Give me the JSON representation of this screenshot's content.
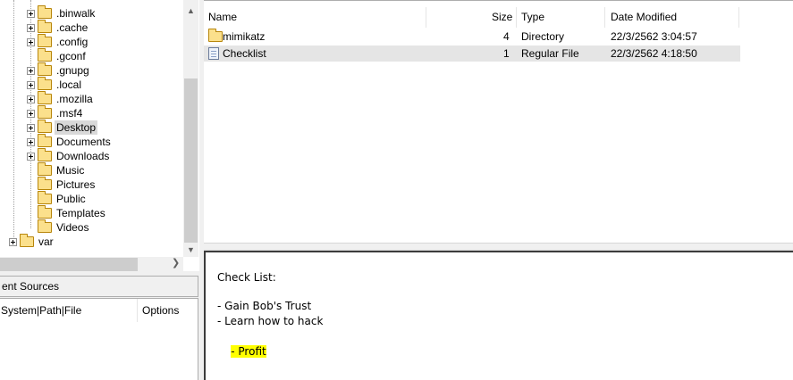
{
  "tree": {
    "items": [
      {
        "label": ".binwalk",
        "expandable": true
      },
      {
        "label": ".cache",
        "expandable": true
      },
      {
        "label": ".config",
        "expandable": true
      },
      {
        "label": ".gconf",
        "expandable": false
      },
      {
        "label": ".gnupg",
        "expandable": true
      },
      {
        "label": ".local",
        "expandable": true
      },
      {
        "label": ".mozilla",
        "expandable": true
      },
      {
        "label": ".msf4",
        "expandable": true
      },
      {
        "label": "Desktop",
        "expandable": true,
        "selected": true
      },
      {
        "label": "Documents",
        "expandable": true
      },
      {
        "label": "Downloads",
        "expandable": true
      },
      {
        "label": "Music",
        "expandable": false
      },
      {
        "label": "Pictures",
        "expandable": false
      },
      {
        "label": "Public",
        "expandable": false
      },
      {
        "label": "Templates",
        "expandable": false
      },
      {
        "label": "Videos",
        "expandable": false
      }
    ],
    "root_item": {
      "label": "var",
      "expandable": true
    }
  },
  "sources_panel": {
    "title": "ent Sources",
    "columns": [
      "System|Path|File",
      "Options"
    ]
  },
  "file_list": {
    "columns": {
      "name": "Name",
      "size": "Size",
      "type": "Type",
      "modified": "Date Modified"
    },
    "rows": [
      {
        "name": "mimikatz",
        "size": "4",
        "type": "Directory",
        "modified": "22/3/2562 3:04:57",
        "icon": "folder-icon"
      },
      {
        "name": "Checklist",
        "size": "1",
        "type": "Regular File",
        "modified": "22/3/2562 4:18:50",
        "icon": "file-icon",
        "selected": true
      }
    ]
  },
  "text_viewer": {
    "lines": [
      "Check List:",
      "",
      "- Gain Bob's Trust",
      "- Learn how to hack",
      "- Profit"
    ],
    "highlighted_line": "- Profit",
    "highlight_color": "#ffff00"
  }
}
